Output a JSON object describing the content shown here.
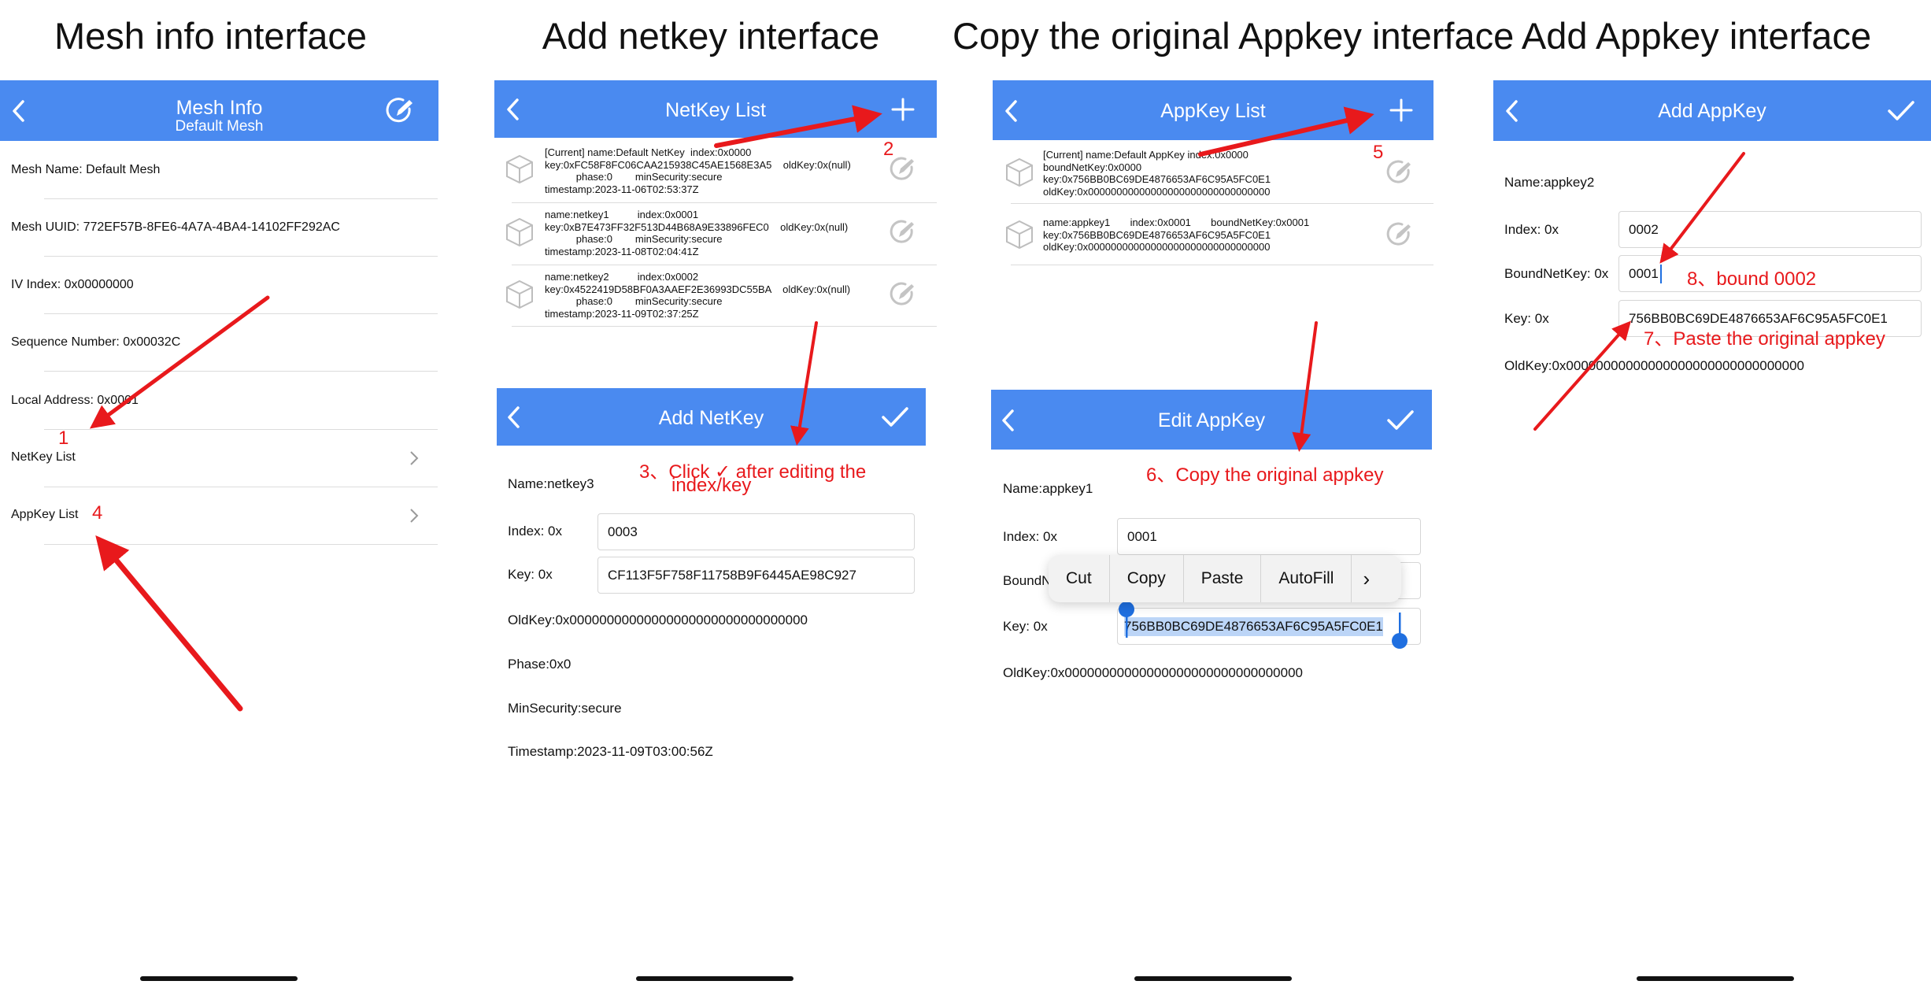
{
  "captions": {
    "c1": "Mesh info interface",
    "c2": "Add netkey interface",
    "c3": "Copy the original Appkey interface",
    "c4": "Add Appkey interface"
  },
  "mesh_info": {
    "title": "Mesh Info",
    "subtitle": "Default Mesh",
    "rows": {
      "name": "Mesh Name: Default Mesh",
      "uuid": "Mesh UUID: 772EF57B-8FE6-4A7A-4BA4-14102FF292AC",
      "iv": "IV Index: 0x00000000",
      "seq": "Sequence Number: 0x00032C",
      "local": "Local Address: 0x0001",
      "netkey": "NetKey List",
      "appkey": "AppKey List"
    }
  },
  "netkey_list": {
    "title": "NetKey List",
    "items": [
      {
        "text": "[Current] name:Default NetKey  index:0x0000\nkey:0xFC58F8FC06CAA215938C45AE1568E3A5    oldKey:0x(null)\n           phase:0        minSecurity:secure\ntimestamp:2023-11-06T02:53:37Z"
      },
      {
        "text": "name:netkey1          index:0x0001\nkey:0xB7E473FF32F513D44B68A9E33896FEC0    oldKey:0x(null)\n           phase:0        minSecurity:secure\ntimestamp:2023-11-08T02:04:41Z"
      },
      {
        "text": "name:netkey2          index:0x0002\nkey:0x4522419D58BF0A3AAEF2E36993DC55BA    oldKey:0x(null)\n           phase:0        minSecurity:secure\ntimestamp:2023-11-09T02:37:25Z"
      }
    ]
  },
  "add_netkey": {
    "title": "Add NetKey",
    "name": "Name:netkey3",
    "index_label": "Index: 0x",
    "index_value": "0003",
    "key_label": "Key: 0x",
    "key_value": "CF113F5F758F11758B9F6445AE98C927",
    "oldkey": "OldKey:0x00000000000000000000000000000000",
    "phase": "Phase:0x0",
    "minsec": "MinSecurity:secure",
    "timestamp": "Timestamp:2023-11-09T03:00:56Z"
  },
  "appkey_list": {
    "title": "AppKey List",
    "items": [
      {
        "text": "[Current] name:Default AppKey index:0x0000\nboundNetKey:0x0000\nkey:0x756BB0BC69DE4876653AF6C95A5FC0E1\noldKey:0x00000000000000000000000000000000"
      },
      {
        "text": "name:appkey1       index:0x0001       boundNetKey:0x0001\nkey:0x756BB0BC69DE4876653AF6C95A5FC0E1\noldKey:0x00000000000000000000000000000000"
      }
    ]
  },
  "edit_appkey": {
    "title": "Edit AppKey",
    "name": "Name:appkey1",
    "index_label": "Index: 0x",
    "index_value": "0001",
    "bound_label_partial": "BoundN",
    "key_label": "Key: 0x",
    "key_value": "756BB0BC69DE4876653AF6C95A5FC0E1",
    "oldkey": "OldKey:0x00000000000000000000000000000000",
    "menu": [
      "Cut",
      "Copy",
      "Paste",
      "AutoFill",
      "›"
    ]
  },
  "add_appkey": {
    "title": "Add AppKey",
    "name": "Name:appkey2",
    "index_label": "Index: 0x",
    "index_value": "0002",
    "bound_label": "BoundNetKey: 0x",
    "bound_value": "0001",
    "key_label": "Key: 0x",
    "key_value": "756BB0BC69DE4876653AF6C95A5FC0E1",
    "oldkey": "OldKey:0x00000000000000000000000000000000"
  },
  "annotations": {
    "a1": "1",
    "a2": "2",
    "a3_line1": "3、Click ✓ after editing the",
    "a3_line2": "index/key",
    "a4": "4",
    "a5": "5",
    "a6": "6、Copy the original appkey",
    "a7": "7、Paste the original appkey",
    "a8": "8、bound 0002"
  },
  "icons": {
    "back": "chevron-left-icon",
    "edit": "edit-pen-icon",
    "add": "plus-icon",
    "check": "checkmark-icon",
    "cube": "cube-icon",
    "disclosure": "chevron-right-icon"
  },
  "colors": {
    "navbar": "#4a8af0",
    "annotation": "#e8191c",
    "selection": "#bcd5f7",
    "handle": "#1f6fe0"
  }
}
